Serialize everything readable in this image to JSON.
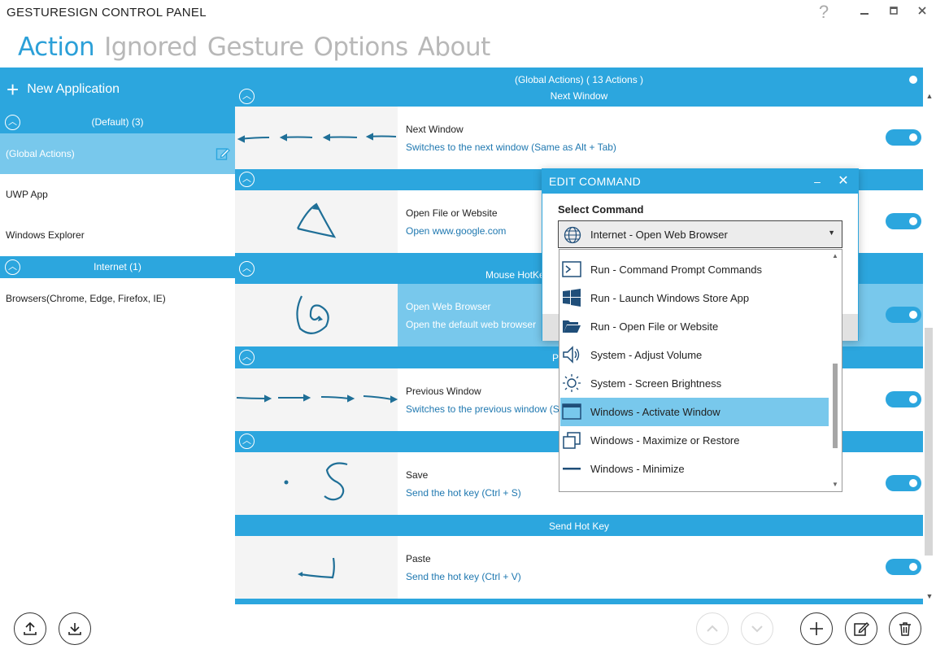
{
  "window": {
    "title": "GESTURESIGN CONTROL PANEL",
    "help_label": "?",
    "minimize_label": "▁",
    "maximize_label": "▫",
    "close_label": "✕"
  },
  "nav": {
    "tabs": [
      "Action",
      "Ignored",
      "Gesture",
      "Options",
      "About"
    ],
    "active": "Action"
  },
  "sidebar": {
    "new_application_label": "New Application",
    "groups": [
      {
        "header": "(Default) (3)",
        "items": [
          "(Global Actions)",
          "UWP App",
          "Windows Explorer"
        ],
        "selected": "(Global Actions)"
      },
      {
        "header": "Internet (1)",
        "items": [
          "Browsers(Chrome, Edge, Firefox, IE)"
        ]
      }
    ]
  },
  "main": {
    "top_header": "(Global Actions)   ( 13 Actions )",
    "sections": [
      {
        "header": "Next Window"
      },
      {
        "header": ""
      },
      {
        "header": "Mouse HotKe"
      },
      {
        "header": "P"
      },
      {
        "header": ""
      },
      {
        "header": "Send Hot Key"
      }
    ],
    "rows": [
      {
        "name": "Next Window",
        "desc": "Switches to the next window (Same as Alt + Tab)",
        "enabled": true
      },
      {
        "name": "Open File or Website",
        "desc": "Open www.google.com",
        "enabled": true
      },
      {
        "name": "Open Web Browser",
        "desc": "Open the default web browser",
        "enabled": true,
        "selected": true
      },
      {
        "name": "Previous Window",
        "desc": "Switches to the previous window (S",
        "enabled": true
      },
      {
        "name": "Save",
        "desc": "Send the hot key (Ctrl + S)",
        "enabled": true
      },
      {
        "name": "Paste",
        "desc": "Send the hot key (Ctrl + V)",
        "enabled": true
      }
    ]
  },
  "dialog": {
    "title": "EDIT COMMAND",
    "minimize_label": "–",
    "close_label": "✕",
    "select_label": "Select Command",
    "selected_value": "Internet - Open Web Browser",
    "options": [
      {
        "label": "Run - Command Prompt Commands",
        "icon": "terminal-icon"
      },
      {
        "label": "Run - Launch Windows Store App",
        "icon": "windows-logo-icon"
      },
      {
        "label": "Run - Open File or Website",
        "icon": "folder-open-icon"
      },
      {
        "label": "System - Adjust Volume",
        "icon": "speaker-icon"
      },
      {
        "label": "System - Screen Brightness",
        "icon": "sun-icon"
      },
      {
        "label": "Windows - Activate Window",
        "icon": "window-icon",
        "highlighted": true
      },
      {
        "label": "Windows - Maximize or Restore",
        "icon": "restore-icon"
      },
      {
        "label": "Windows - Minimize",
        "icon": "minimize-bar-icon"
      }
    ]
  },
  "toolbar": {
    "buttons": [
      "upload-icon",
      "download-icon",
      "move-up-icon",
      "move-down-icon",
      "add-icon",
      "edit-icon",
      "delete-icon"
    ]
  },
  "colors": {
    "accent": "#2ca6de",
    "selected": "#78c8ec",
    "link": "#1f78b0"
  }
}
